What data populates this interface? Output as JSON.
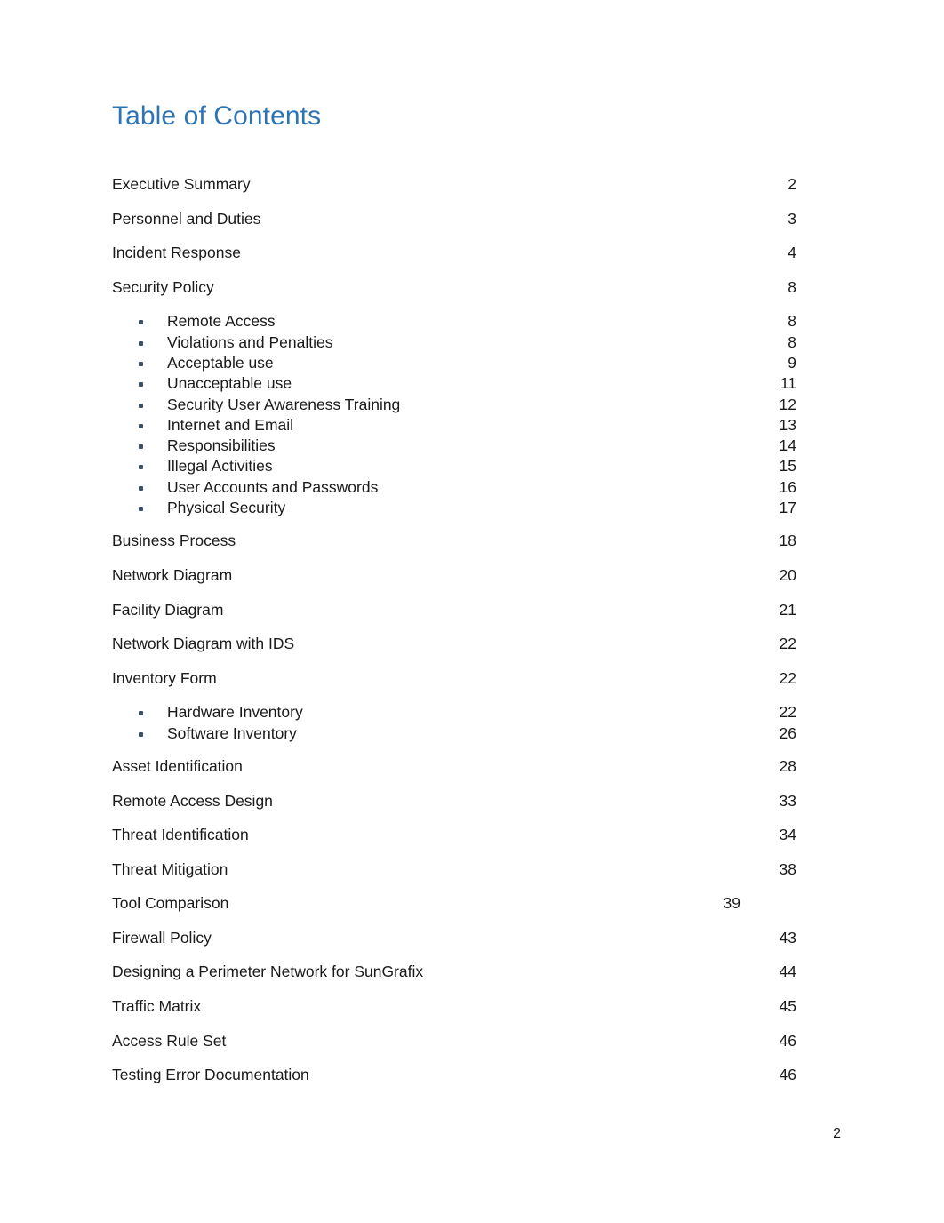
{
  "document": {
    "heading": "Table of Contents",
    "heading_color": "#2E74B5",
    "bullet_color": "#3C5068",
    "text_color": "#1a1a1a",
    "footer_page_number": "2"
  },
  "toc": {
    "entries": [
      {
        "title": "Executive Summary",
        "page": "2"
      },
      {
        "title": "Personnel and Duties",
        "page": "3"
      },
      {
        "title": "Incident Response",
        "page": "4"
      },
      {
        "title": "Security Policy",
        "page": "8"
      },
      {
        "title": "Business Process",
        "page": "18"
      },
      {
        "title": "Network Diagram",
        "page": "20"
      },
      {
        "title": "Facility Diagram",
        "page": "21"
      },
      {
        "title": "Network Diagram with IDS",
        "page": "22"
      },
      {
        "title": "Inventory Form",
        "page": "22"
      },
      {
        "title": "Asset Identification",
        "page": "28"
      },
      {
        "title": "Remote Access Design",
        "page": "33"
      },
      {
        "title": "Threat Identification",
        "page": "34"
      },
      {
        "title": "Threat Mitigation",
        "page": "38"
      },
      {
        "title": "Tool Comparison",
        "page": "39"
      },
      {
        "title": "Firewall Policy",
        "page": "43"
      },
      {
        "title": "Designing a Perimeter Network for SunGrafix",
        "page": "44"
      },
      {
        "title": "Traffic Matrix",
        "page": "45"
      },
      {
        "title": "Access Rule Set",
        "page": "46"
      },
      {
        "title": "Testing Error Documentation",
        "page": "46"
      }
    ],
    "security_policy_subitems": [
      {
        "title": "Remote Access",
        "page": "8"
      },
      {
        "title": "Violations and Penalties",
        "page": "8"
      },
      {
        "title": "Acceptable use",
        "page": "9"
      },
      {
        "title": "Unacceptable use",
        "page": "11"
      },
      {
        "title": "Security User Awareness Training",
        "page": "12"
      },
      {
        "title": "Internet and Email",
        "page": "13"
      },
      {
        "title": "Responsibilities",
        "page": "14"
      },
      {
        "title": "Illegal Activities",
        "page": "15"
      },
      {
        "title": "User Accounts and Passwords",
        "page": "16"
      },
      {
        "title": "Physical Security",
        "page": "17"
      }
    ],
    "inventory_form_subitems": [
      {
        "title": "Hardware Inventory",
        "page": "22"
      },
      {
        "title": "Software Inventory",
        "page": "26"
      }
    ]
  }
}
